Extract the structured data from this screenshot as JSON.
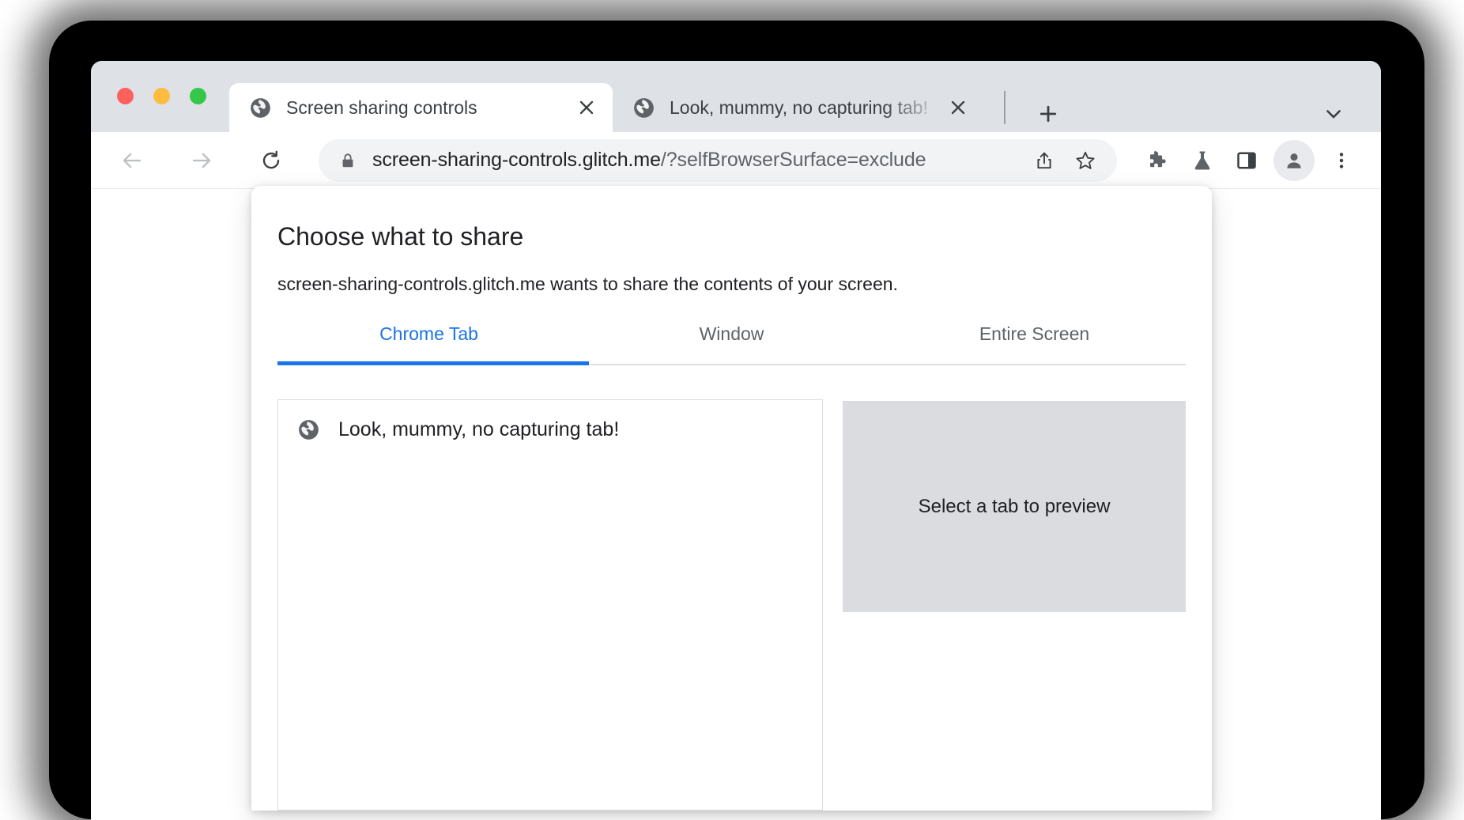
{
  "window": {
    "traffic_lights": [
      "close",
      "minimize",
      "zoom"
    ],
    "colors": {
      "close": "#fc615d",
      "minimize": "#fdbc40",
      "zoom": "#34c749",
      "tabstrip_bg": "#dee1e6",
      "accent": "#1a73e8",
      "omnibox_bg": "#f1f3f4",
      "preview_bg": "#dadce0"
    }
  },
  "tabs": [
    {
      "title": "Screen sharing controls",
      "favicon": "globe-icon",
      "active": true,
      "close_label": "×"
    },
    {
      "title": "Look, mummy, no capturing tab!",
      "favicon": "globe-icon",
      "active": false,
      "close_label": "×"
    }
  ],
  "tab_actions": {
    "new_tab_label": "+",
    "tab_search_label": "⌄"
  },
  "toolbar": {
    "back_label": "←",
    "forward_label": "→",
    "reload_label": "⟳",
    "lock_icon": "lock-icon",
    "url_host": "screen-sharing-controls.glitch.me",
    "url_path": "/?selfBrowserSurface=exclude",
    "share_icon": "share-icon",
    "bookmark_icon": "star-icon",
    "extensions_icon": "puzzle-icon",
    "experiments_icon": "flask-icon",
    "side_panel_icon": "side-panel-icon",
    "profile_icon": "person-icon",
    "menu_icon": "three-dot-menu-icon"
  },
  "dialog": {
    "title": "Choose what to share",
    "subtitle": "screen-sharing-controls.glitch.me wants to share the contents of your screen.",
    "surface_tabs": [
      {
        "label": "Chrome Tab",
        "active": true
      },
      {
        "label": "Window",
        "active": false
      },
      {
        "label": "Entire Screen",
        "active": false
      }
    ],
    "tab_list": [
      {
        "label": "Look, mummy, no capturing tab!",
        "favicon": "globe-icon"
      }
    ],
    "preview_placeholder": "Select a tab to preview"
  }
}
